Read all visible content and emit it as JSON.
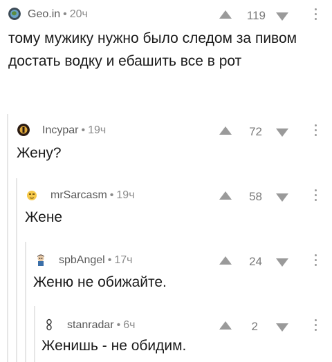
{
  "comments": [
    {
      "author": "Geo.in",
      "separator": "•",
      "time": "20ч",
      "score": "119",
      "avatar_icon": "globe-avatar-icon",
      "text": "тому мужику нужно было следом за пивом достать водку и ебашить все в рот"
    },
    {
      "author": "Incypar",
      "separator": "•",
      "time": "19ч",
      "score": "72",
      "avatar_icon": "badge-avatar-icon",
      "text": "Жену?"
    },
    {
      "author": "mrSarcasm",
      "separator": "•",
      "time": "19ч",
      "score": "58",
      "avatar_icon": "emoji-avatar-icon",
      "text": "Жене"
    },
    {
      "author": "spbAngel",
      "separator": "•",
      "time": "17ч",
      "score": "24",
      "avatar_icon": "character-avatar-icon",
      "text": "Женю не обижайте."
    },
    {
      "author": "stanradar",
      "separator": "•",
      "time": "6ч",
      "score": "2",
      "avatar_icon": "chain-avatar-icon",
      "text": "Женишь - не обидим."
    }
  ],
  "colors": {
    "meta": "#8a8a8a",
    "text": "#1b1b1b",
    "vote_arrow": "#9a9a9a",
    "thread_line": "#e6e6e6"
  }
}
